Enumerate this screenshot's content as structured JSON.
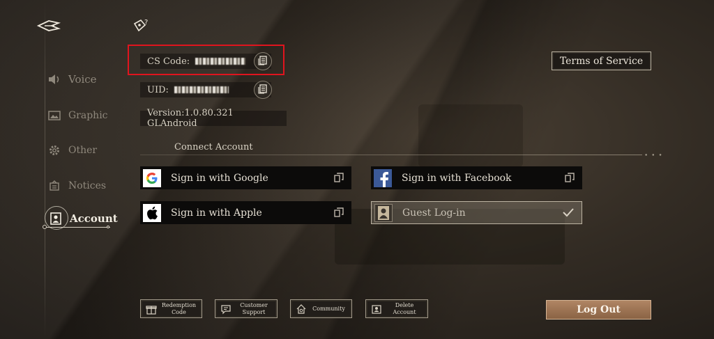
{
  "sidebar": {
    "items": [
      {
        "label": "Voice",
        "icon": "speaker-icon"
      },
      {
        "label": "Graphic",
        "icon": "image-icon"
      },
      {
        "label": "Other",
        "icon": "gear-icon"
      },
      {
        "label": "Notices",
        "icon": "notice-icon"
      },
      {
        "label": "Account",
        "icon": "portrait-icon",
        "active": true
      }
    ]
  },
  "info": {
    "cs_label": "CS Code:",
    "uid_label": "UID:",
    "version": "Version:1.0.80.321 GLAndroid"
  },
  "terms_label": "Terms of Service",
  "connect": {
    "title": "Connect Account",
    "google": "Sign in with Google",
    "facebook": "Sign in with Facebook",
    "apple": "Sign in with Apple",
    "guest": "Guest Log-in"
  },
  "bottom": {
    "redeem": "Redemption\nCode",
    "support": "Customer\nSupport",
    "community": "Community",
    "delete": "Delete\nAccount",
    "logout": "Log Out"
  },
  "colors": {
    "highlight": "#e0141e",
    "logout": "#9a7150",
    "facebook": "#3b5998"
  }
}
